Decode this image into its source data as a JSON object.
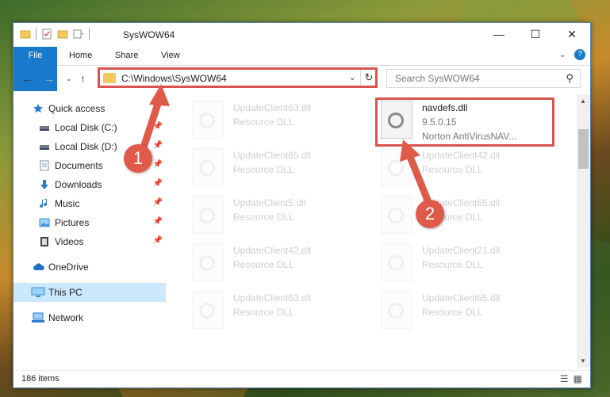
{
  "window": {
    "title": "SysWOW64",
    "controls": [
      "minimize-icon",
      "maximize-icon",
      "close-icon"
    ]
  },
  "ribbon": {
    "tabs": [
      "File",
      "Home",
      "Share",
      "View"
    ]
  },
  "navigation": {
    "address": "C:\\Windows\\SysWOW64",
    "search_placeholder": "Search SysWOW64"
  },
  "sidebar": {
    "items": [
      {
        "label": "Quick access",
        "icon": "star-icon",
        "color": "#2b79d0",
        "pinned": false
      },
      {
        "label": "Local Disk (C:)",
        "icon": "drive-icon",
        "color": "#6c7a89",
        "pinned": true
      },
      {
        "label": "Local Disk (D:)",
        "icon": "drive-icon",
        "color": "#6c7a89",
        "pinned": true
      },
      {
        "label": "Documents",
        "icon": "documents-icon",
        "color": "#7a8fa6",
        "pinned": true
      },
      {
        "label": "Downloads",
        "icon": "download-icon",
        "color": "#2b79d0",
        "pinned": true
      },
      {
        "label": "Music",
        "icon": "music-icon",
        "color": "#2b79d0",
        "pinned": true
      },
      {
        "label": "Pictures",
        "icon": "pictures-icon",
        "color": "#3a8fd8",
        "pinned": true
      },
      {
        "label": "Videos",
        "icon": "video-icon",
        "color": "#444444",
        "pinned": true
      },
      {
        "label": "OneDrive",
        "icon": "cloud-icon",
        "color": "#1f6fc5",
        "pinned": false
      },
      {
        "label": "This PC",
        "icon": "computer-icon",
        "color": "#3a8fd8",
        "pinned": false,
        "selected": true
      },
      {
        "label": "Network",
        "icon": "network-icon",
        "color": "#2b79d0",
        "pinned": false
      }
    ]
  },
  "files": {
    "left_column": [
      {
        "name": "UpdateClient63.dll",
        "type": "Resource DLL"
      },
      {
        "name": "UpdateClient65.dll",
        "type": "Resource DLL"
      },
      {
        "name": "UpdateClient5.dll",
        "type": "Resource DLL"
      },
      {
        "name": "UpdateClient42.dll",
        "type": "Resource DLL"
      },
      {
        "name": "UpdateClient63.dll",
        "type": "Resource DLL"
      }
    ],
    "right_column": [
      {
        "name": "navdefs.dll",
        "version": "9.5.0.15",
        "description": "Norton AntiVirusNAV..."
      },
      {
        "name": "UpdateClient42.dll",
        "type": "Resource DLL"
      },
      {
        "name": "UpdateClient65.dll",
        "type": "Resource DLL"
      },
      {
        "name": "UpdateClient21.dll",
        "type": "Resource DLL"
      },
      {
        "name": "UpdateClient65.dll",
        "type": "Resource DLL"
      }
    ]
  },
  "status": {
    "item_count": "186 items"
  },
  "annotations": {
    "step1": "1",
    "step2": "2",
    "color": "#e05a4a"
  }
}
